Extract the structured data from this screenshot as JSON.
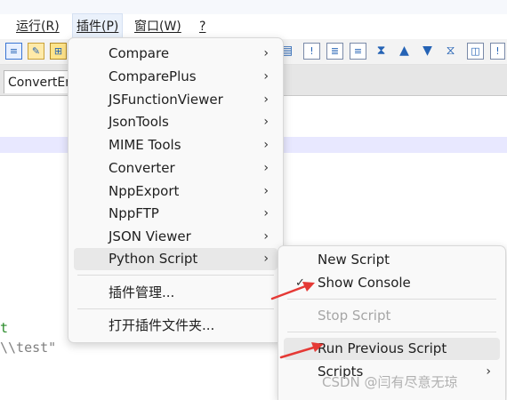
{
  "menubar": {
    "items": [
      {
        "label": "运行(R)"
      },
      {
        "label": "插件(P)"
      },
      {
        "label": "窗口(W)"
      },
      {
        "label": "?"
      }
    ]
  },
  "tab": {
    "label": "ConvertEr"
  },
  "editor": {
    "line1": "t",
    "line2": "\\\\test\""
  },
  "plugins_menu": {
    "items": [
      {
        "label": "Compare"
      },
      {
        "label": "ComparePlus"
      },
      {
        "label": "JSFunctionViewer"
      },
      {
        "label": "JsonTools"
      },
      {
        "label": "MIME Tools"
      },
      {
        "label": "Converter"
      },
      {
        "label": "NppExport"
      },
      {
        "label": "NppFTP"
      },
      {
        "label": "JSON Viewer"
      },
      {
        "label": "Python Script"
      },
      {
        "label": "插件管理..."
      },
      {
        "label": "打开插件文件夹..."
      }
    ]
  },
  "python_menu": {
    "items": [
      {
        "label": "New Script"
      },
      {
        "label": "Show Console"
      },
      {
        "label": "Stop Script"
      },
      {
        "label": "Run Previous Script"
      },
      {
        "label": "Scripts"
      }
    ]
  },
  "watermark": "CSDN @闫有尽意无琼",
  "colors": {
    "arrow": "#e53935",
    "highlight": "#e8e8e8",
    "accent": "#2563b5"
  }
}
